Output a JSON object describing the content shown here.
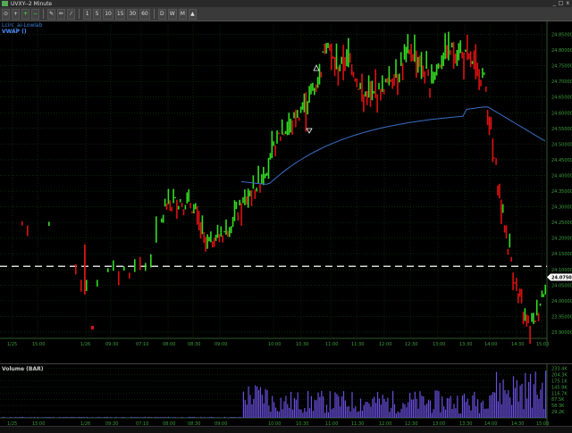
{
  "window": {
    "title": "UVXY--2 Minute"
  },
  "toolbar": {
    "buttons": [
      {
        "icon": "cursor-icon",
        "label": "⊙"
      },
      {
        "icon": "crosshair-icon",
        "label": "+"
      },
      {
        "icon": "zoom-in-icon",
        "label": "+"
      },
      {
        "icon": "zoom-out-icon",
        "label": "−"
      },
      {
        "icon": "draw-icon",
        "label": "✎"
      },
      {
        "icon": "pencil-icon",
        "label": "✏"
      },
      {
        "icon": "line-tool-icon",
        "label": "⁄"
      },
      {
        "icon": "bar-interval-icon",
        "label": "1"
      },
      {
        "icon": "interval-5-icon",
        "label": "5"
      },
      {
        "icon": "interval-10-icon",
        "label": "10"
      },
      {
        "icon": "interval-15-icon",
        "label": "15"
      },
      {
        "icon": "interval-30-icon",
        "label": "30"
      },
      {
        "icon": "interval-60-icon",
        "label": "60"
      },
      {
        "icon": "daily-icon",
        "label": "D"
      },
      {
        "icon": "weekly-icon",
        "label": "W"
      },
      {
        "icon": "monthly-icon",
        "label": "M"
      },
      {
        "icon": "alert-icon",
        "label": "▲"
      }
    ]
  },
  "legends": {
    "main": "Lcirc_ai-Lowlab",
    "vwap": "VWAP ()",
    "volume": "Volume (BAR)"
  },
  "colors": {
    "up_bar": "#33dd22",
    "down_bar": "#dd1111",
    "vwap": "#3b6fc8",
    "volume": "#6a4fe0",
    "grid": "#164016",
    "axis": "#2d5a2d",
    "dashed_line": "#ffffff"
  },
  "price_axis": {
    "ticks": [
      "24.85000",
      "24.80000",
      "24.75000",
      "24.70000",
      "24.65000",
      "24.60000",
      "24.55000",
      "24.50000",
      "24.45000",
      "24.40000",
      "24.35000",
      "24.30000",
      "24.25000",
      "24.20000",
      "24.15000",
      "24.10000",
      "24.05000",
      "24.00000",
      "23.95000",
      "23.90000"
    ],
    "last_price_label": "24.0750"
  },
  "volume_axis": {
    "ticks": [
      "233.4K",
      "204.3K",
      "175.1K",
      "145.9K",
      "116.7K",
      "87.5K",
      "58.3K",
      "29.2K"
    ]
  },
  "time_axis": {
    "labels": [
      "1/25",
      "15:00",
      "1/26",
      "09:30",
      "07:10",
      "08:00",
      "08:30",
      "09:00",
      "10:00",
      "10:30",
      "11:00",
      "11:30",
      "12:00",
      "12:30",
      "13:00",
      "13:30",
      "14:00",
      "14:30",
      "15:00"
    ]
  },
  "chart_data": {
    "type": "bar",
    "title": "UVXY--2 Minute",
    "ylabel": "",
    "xlabel": "",
    "ylim": [
      23.88,
      24.88
    ],
    "reference_line": 24.11,
    "series": [
      {
        "name": "VWAP ()",
        "values": []
      }
    ],
    "volume_ylim": [
      0,
      240
    ]
  }
}
